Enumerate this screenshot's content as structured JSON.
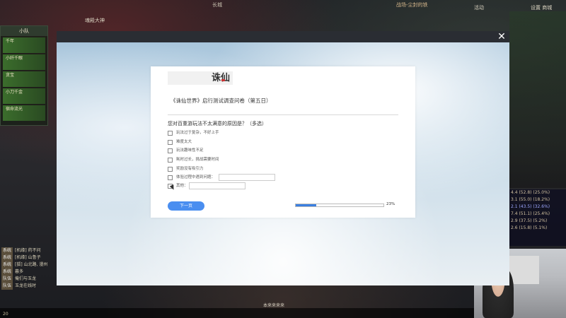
{
  "game": {
    "top_title": "长城",
    "top_left_b": "魂殿大神",
    "top_right_a": "战场-尘封的铁",
    "top_right_b": "活动",
    "top_right_c": "设置 商城",
    "party_title": "小队",
    "members": [
      "千年",
      "小纤千眼",
      "贪宝",
      "小刀千金",
      "宿命流光"
    ],
    "stats": [
      "4.4 (52.8) (25.0%)",
      "3.1 (55.0) (18.2%)",
      "2.1 (43.5) (32.6%)",
      "7.4 (51.1) (25.4%)",
      "2.9 (37.5) (5.2%)",
      "2.6 (15.8) (5.1%)"
    ],
    "chat": [
      {
        "tag": "系统",
        "text": "[机缘] 药不问"
      },
      {
        "tag": "系统",
        "text": "[机缘] 山鲁子"
      },
      {
        "tag": "系统",
        "text": "[狐] 山北路, 漫州"
      },
      {
        "tag": "系统",
        "text": "暮多"
      },
      {
        "tag": "队伍",
        "text": "俺们与玉龙"
      },
      {
        "tag": "队伍",
        "text": "玉龙在线时"
      }
    ],
    "bottom_left": "20",
    "bottom_center": "本来来来来"
  },
  "overlay": {
    "close_label": "✕"
  },
  "survey": {
    "logo_text": "诛仙",
    "title": "《诛仙世界》启行测试调查问卷（第五日）",
    "question": "您对百重游玩法不太满意的原因是？（多选）",
    "options": [
      {
        "label": "玩法过于复杂，不好上手",
        "has_input": false
      },
      {
        "label": "难度太大",
        "has_input": false
      },
      {
        "label": "玩法趣味性不足",
        "has_input": false
      },
      {
        "label": "耗时过长，挑战需要时间",
        "has_input": false
      },
      {
        "label": "奖励没有吸引力",
        "has_input": false
      },
      {
        "label": "体验过程中遇到问题：",
        "has_input": true
      },
      {
        "label": "其他：",
        "has_input": true
      }
    ],
    "prev_button": "下一页",
    "progress_percent": 23,
    "progress_label": "23%"
  },
  "colors": {
    "accent": "#4a8ef0",
    "progress": "#3a7fe0"
  }
}
